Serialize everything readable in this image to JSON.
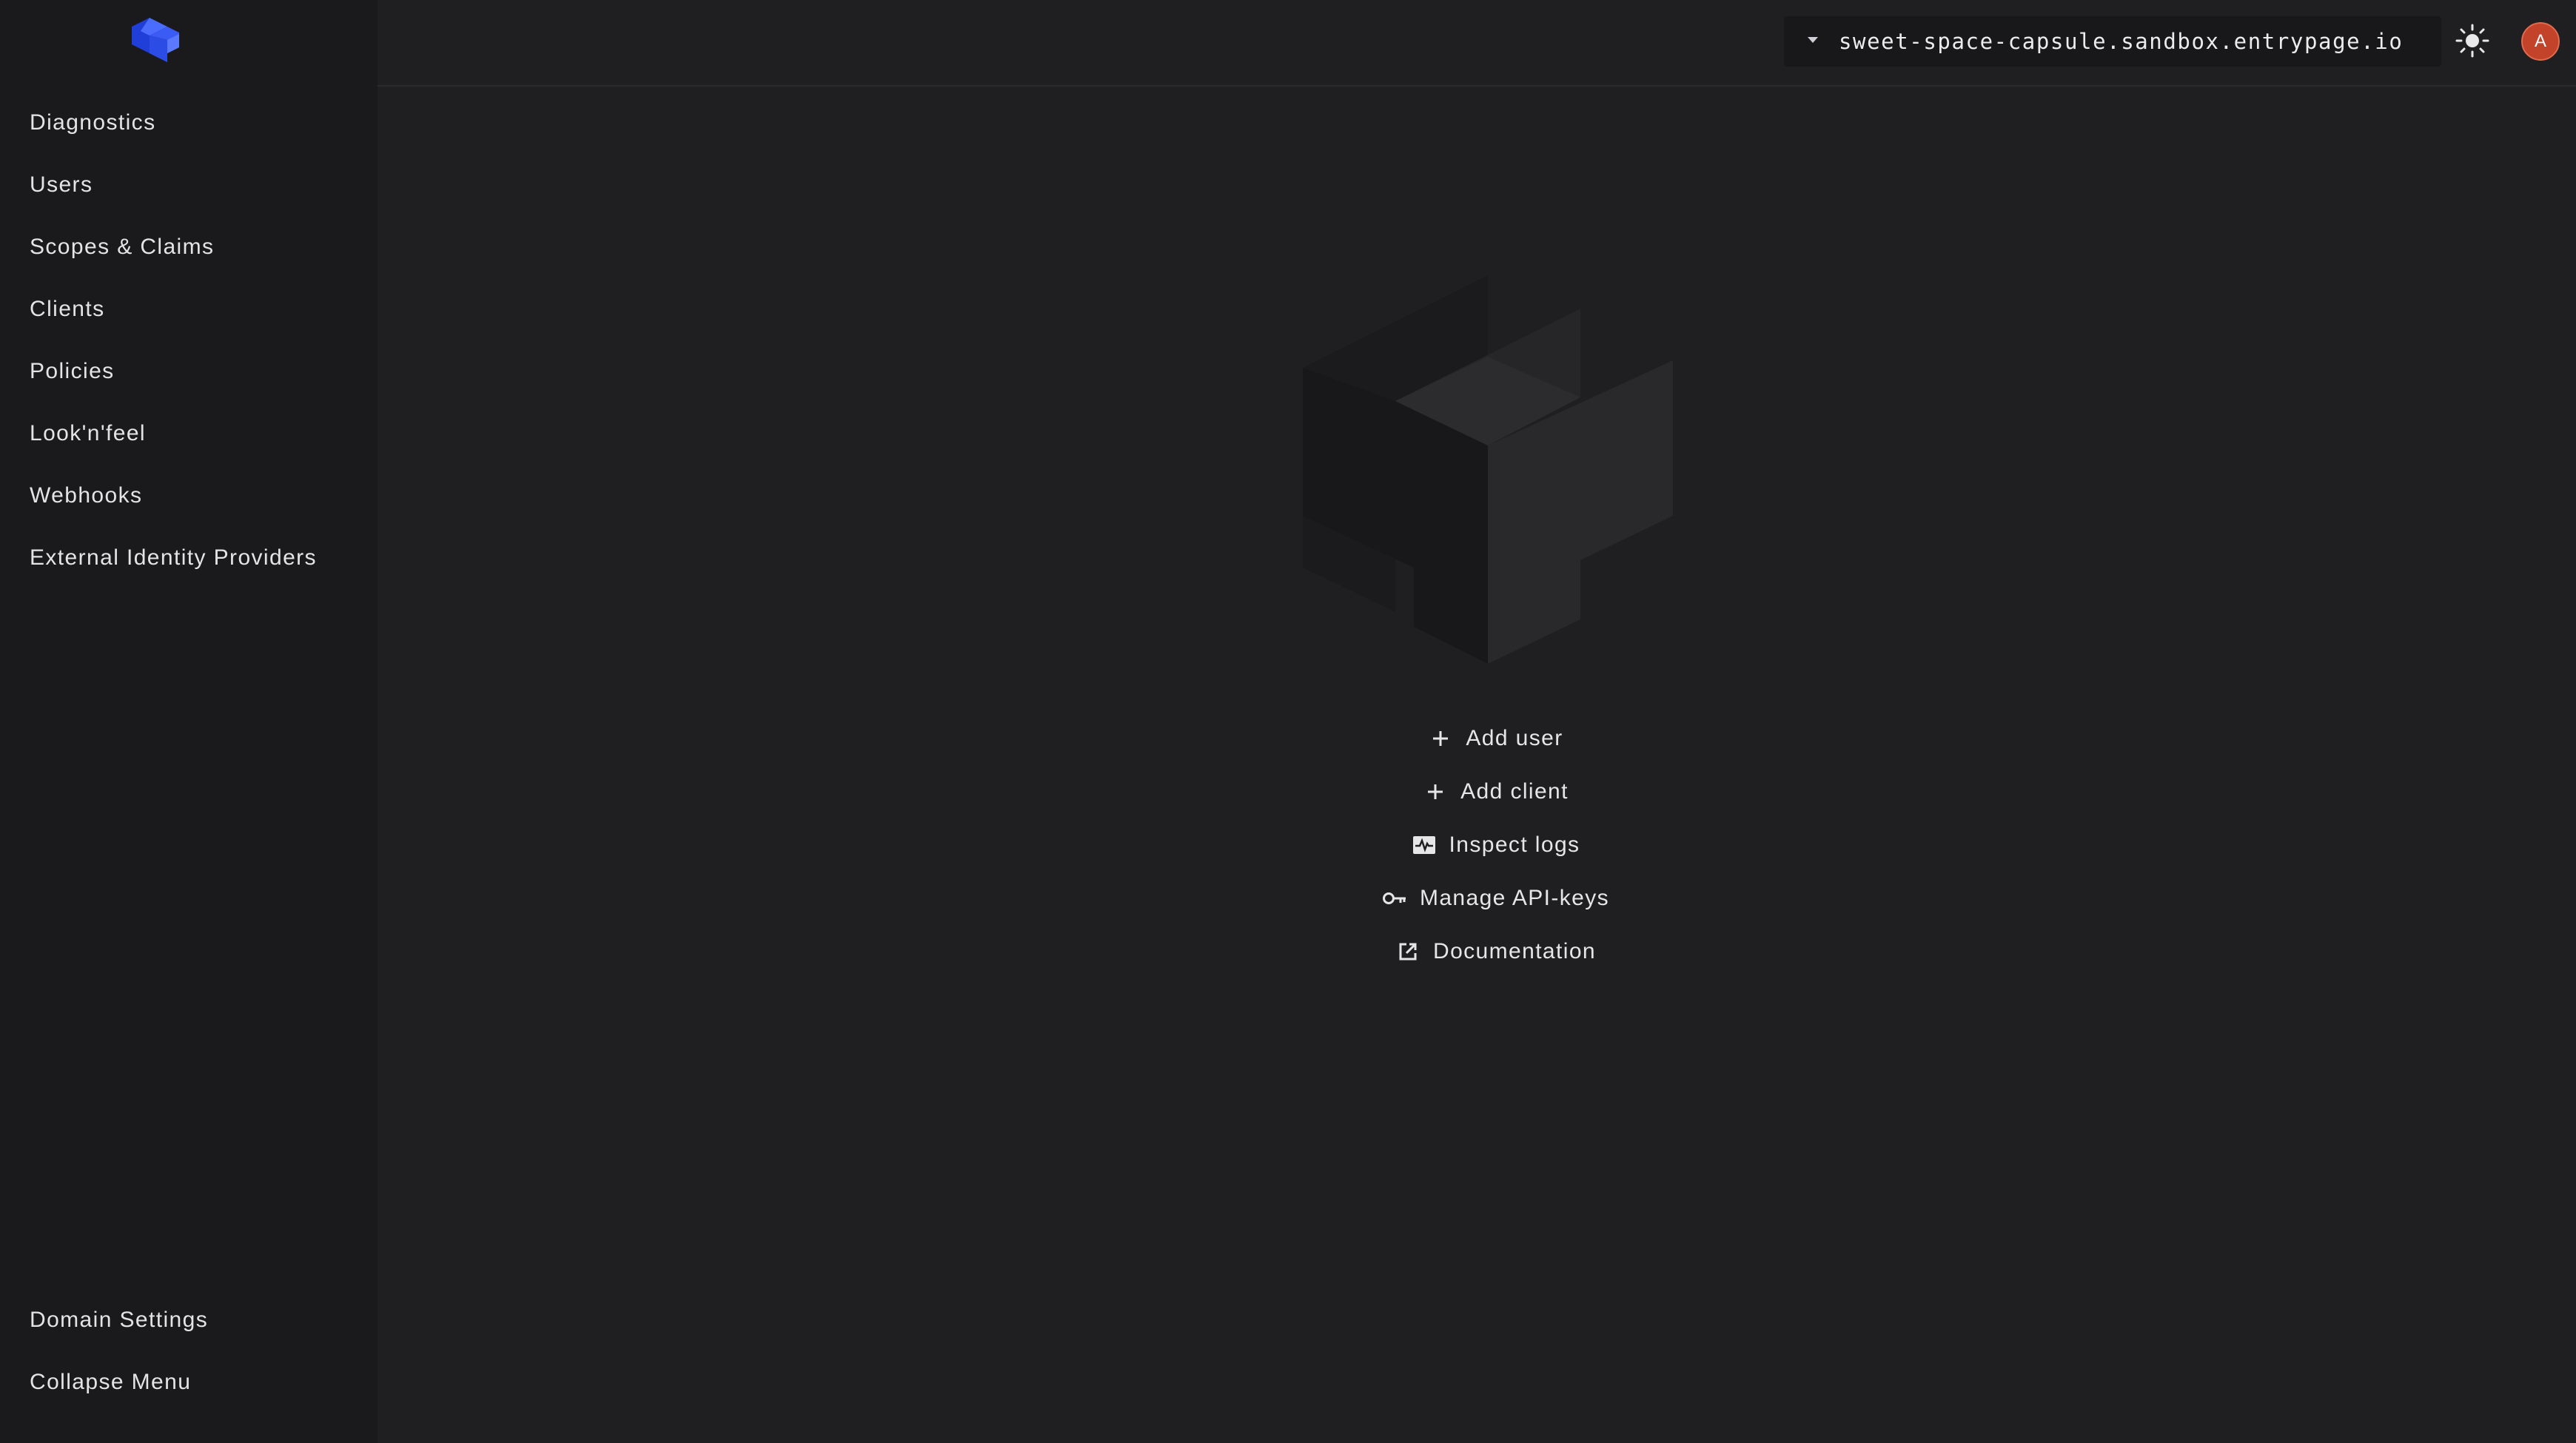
{
  "sidebar": {
    "logo_icon": "cube-logo-icon",
    "items": [
      {
        "label": "Diagnostics"
      },
      {
        "label": "Users"
      },
      {
        "label": "Scopes & Claims"
      },
      {
        "label": "Clients"
      },
      {
        "label": "Policies"
      },
      {
        "label": "Look'n'feel"
      },
      {
        "label": "Webhooks"
      },
      {
        "label": "External Identity Providers"
      }
    ],
    "bottom_items": [
      {
        "label": "Domain Settings"
      },
      {
        "label": "Collapse Menu"
      }
    ]
  },
  "topbar": {
    "domain": "sweet-space-capsule.sandbox.entrypage.io",
    "theme_icon": "sun-icon",
    "avatar_initial": "A"
  },
  "main": {
    "actions": [
      {
        "label": "Add user",
        "icon": "plus-icon"
      },
      {
        "label": "Add client",
        "icon": "plus-icon"
      },
      {
        "label": "Inspect logs",
        "icon": "activity-icon"
      },
      {
        "label": "Manage API-keys",
        "icon": "key-icon"
      },
      {
        "label": "Documentation",
        "icon": "external-link-icon"
      }
    ]
  },
  "colors": {
    "background": "#1f1f21",
    "sidebar": "#1a1a1c",
    "accent": "#2f5bff",
    "avatar": "#c2432a"
  }
}
